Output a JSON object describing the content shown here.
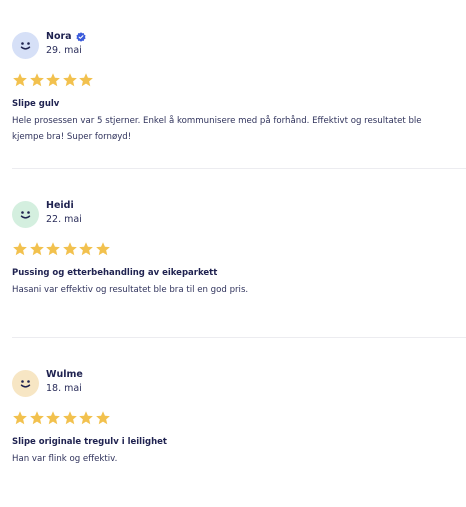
{
  "reviews": [
    {
      "name": "Nora",
      "verified": true,
      "date": "29. mai",
      "rating": 5,
      "title": "Slipe gulv",
      "text": "Hele prosessen var 5 stjerner. Enkel å kommunisere med på forhånd. Effektivt og resultatet ble kjempe bra! Super fornøyd!",
      "avatar_color": "#d6e0f7",
      "avatar_icon": "smiley-icon"
    },
    {
      "name": "Heidi",
      "verified": false,
      "date": "22. mai",
      "rating": 5,
      "title": "Pussing og etterbehandling av eikeparkett",
      "text": "Hasani var effektiv og resultatet ble bra til en god pris.",
      "avatar_color": "#d4efdf",
      "avatar_icon": "smiley-icon"
    },
    {
      "name": "Wulme",
      "verified": false,
      "date": "18. mai",
      "rating": 5,
      "title": "Slipe originale tregulv i leilighet",
      "text": "Han var flink og effektiv.",
      "avatar_color": "#f7e6c4",
      "avatar_icon": "smiley-icon"
    }
  ],
  "colors": {
    "star": "#f2c14e",
    "verified_badge": "#3b5bdb",
    "text_primary": "#1f2250",
    "divider": "#ececf0"
  }
}
